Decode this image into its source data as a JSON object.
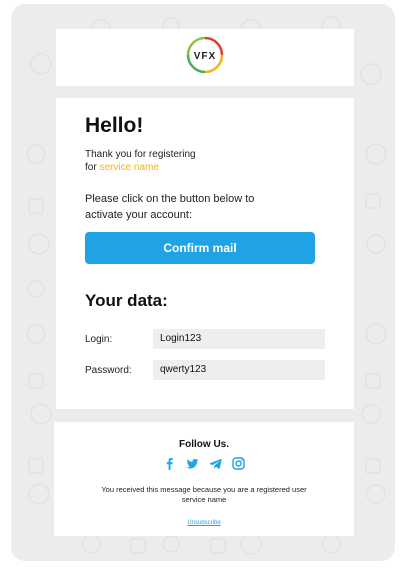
{
  "logo": {
    "text": "VFX"
  },
  "main": {
    "greeting": "Hello!",
    "thanks_line1": "Thank you for registering",
    "thanks_for": "for",
    "service_name": "service name",
    "instruction_line1": "Please click on the button below to",
    "instruction_line2": "activate your account:",
    "confirm_button_label": "Confirm mail",
    "data_heading": "Your data:",
    "login_label": "Login:",
    "login_value": "Login123",
    "password_label": "Password:",
    "password_value": "qwerty123"
  },
  "footer": {
    "follow_label": "Follow Us.",
    "notice_line1": "You received this message because you are a registered user",
    "notice_line2": "service name",
    "unsubscribe_label": "Unsubscribe",
    "social_icons": [
      "facebook-icon",
      "twitter-icon",
      "telegram-icon",
      "instagram-icon"
    ]
  },
  "colors": {
    "accent_blue": "#1fa3e6",
    "accent_yellow": "#f3b21a",
    "background": "#ececec"
  }
}
